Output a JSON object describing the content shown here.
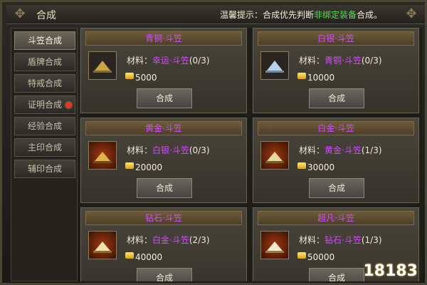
{
  "window": {
    "title": "合成"
  },
  "hint": {
    "prefix": "温馨提示：合成优先判断",
    "highlight": "非绑定装备",
    "suffix": "合成。"
  },
  "sidebar": {
    "items": [
      {
        "label": "斗笠合成",
        "active": true
      },
      {
        "label": "盾牌合成"
      },
      {
        "label": "特戒合成"
      },
      {
        "label": "证明合成",
        "badge": "red-dot"
      },
      {
        "label": "经验合成"
      },
      {
        "label": "主印合成"
      },
      {
        "label": "辅印合成"
      }
    ]
  },
  "common": {
    "material_label": "材料：",
    "combine_label": "合成"
  },
  "cards": [
    {
      "name": "青铜·斗笠",
      "material": "幸运·斗笠",
      "count": "(0/3)",
      "cost": "5000",
      "icon": "bronze-hat-icon"
    },
    {
      "name": "白银·斗笠",
      "material": "青铜·斗笠",
      "count": "(0/3)",
      "cost": "10000",
      "icon": "silver-hat-icon"
    },
    {
      "name": "黄金·斗笠",
      "material": "白银·斗笠",
      "count": "(0/3)",
      "cost": "20000",
      "icon": "gold-hat-icon"
    },
    {
      "name": "白金·斗笠",
      "material": "黄金·斗笠",
      "count": "(1/3)",
      "cost": "30000",
      "icon": "platinum-hat-icon"
    },
    {
      "name": "钻石·斗笠",
      "material": "白金·斗笠",
      "count": "(2/3)",
      "cost": "40000",
      "icon": "diamond-hat-icon"
    },
    {
      "name": "超凡·斗笠",
      "material": "钻石·斗笠",
      "count": "(1/3)",
      "cost": "50000",
      "icon": "transcendent-hat-icon"
    }
  ],
  "watermark": "18183",
  "colors": {
    "item_name": "#d24bff",
    "highlight": "#4ee04e",
    "alert_dot": "#e33a1f"
  }
}
